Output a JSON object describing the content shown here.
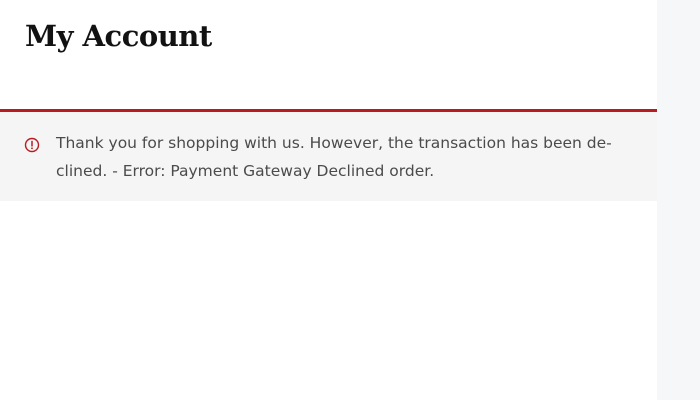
{
  "header": {
    "title": "My Account"
  },
  "notice": {
    "type": "error",
    "icon": "alert-circle-icon",
    "accent_color": "#b81c23",
    "lines": [
      "Thank you for shopping with us. However, the transaction has been de-",
      "clined. - Error: Payment Gateway Declined order."
    ]
  }
}
